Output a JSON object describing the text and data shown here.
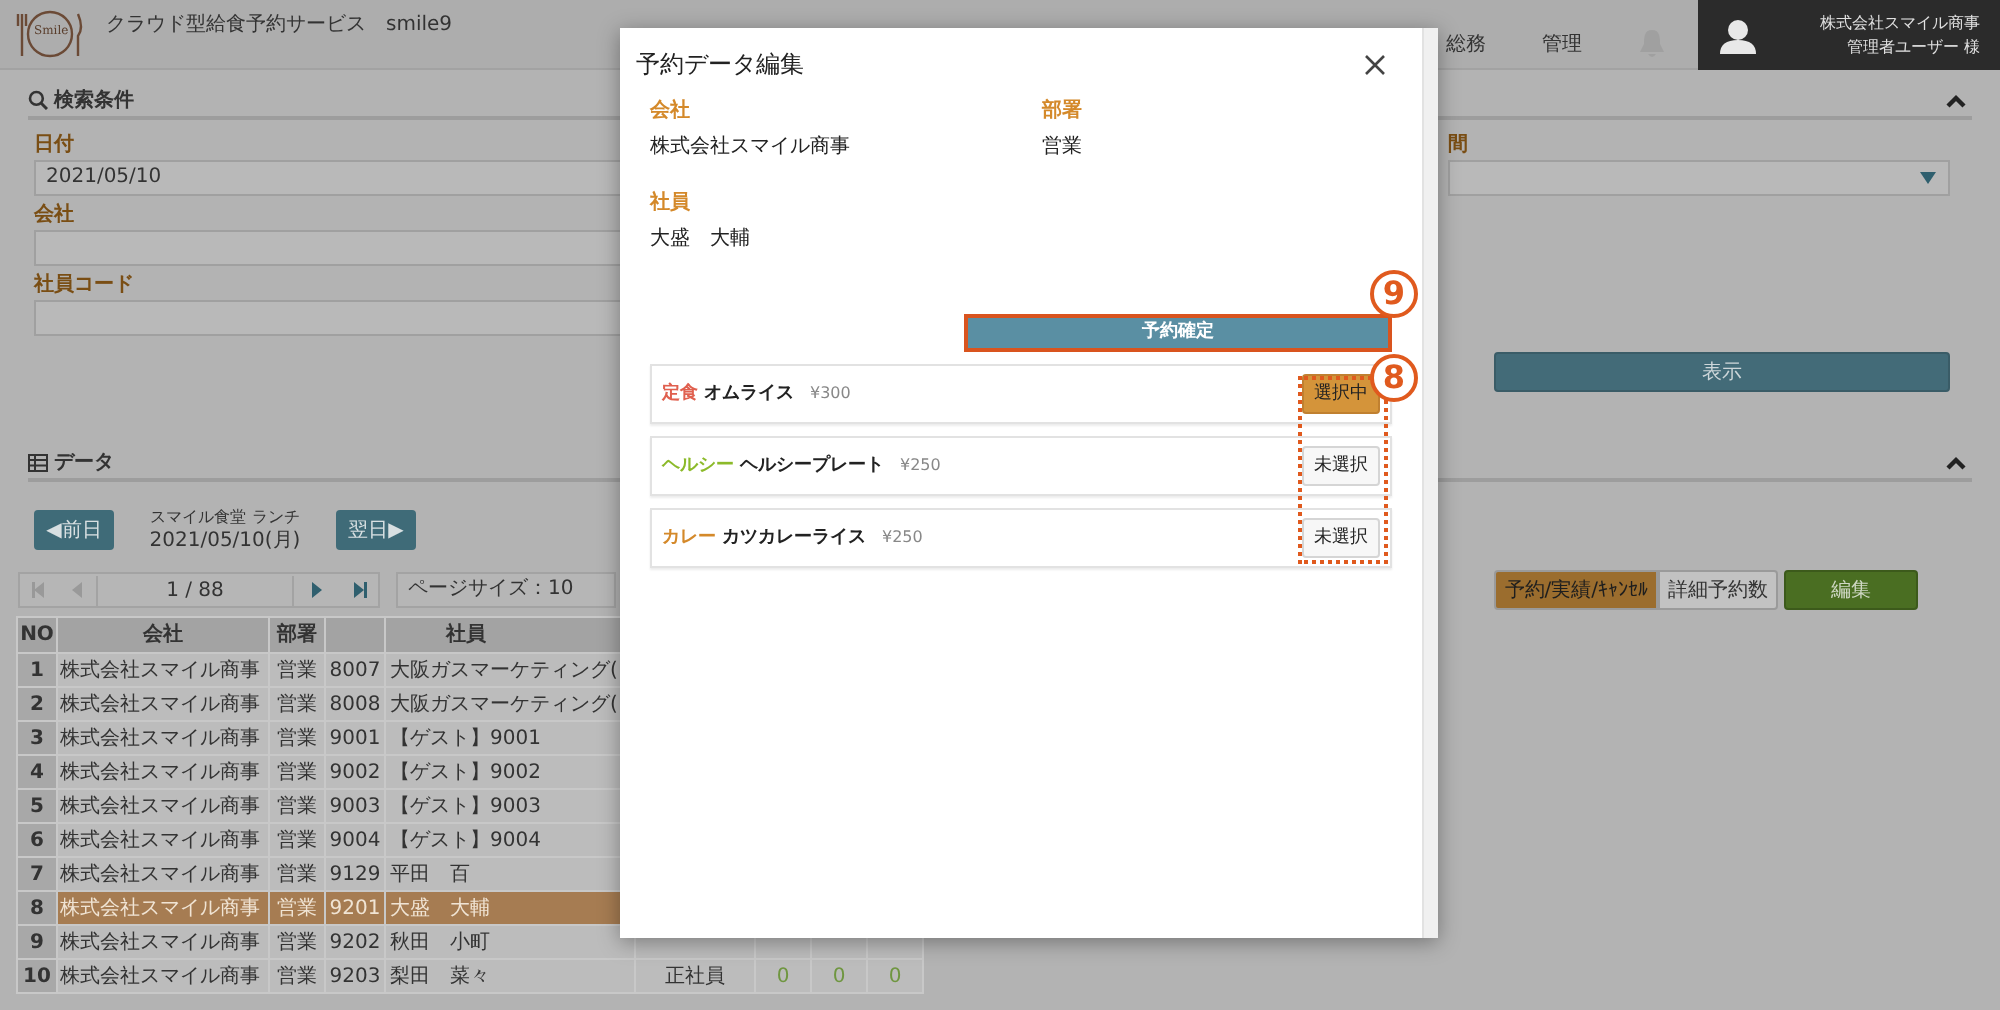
{
  "app": {
    "title": "クラウド型給食予約サービス　smile9",
    "logo_text": "Smile"
  },
  "nav": [
    {
      "label": "総務"
    },
    {
      "label": "管理"
    }
  ],
  "user": {
    "company": "株式会社スマイル商事",
    "name": "管理者ユーザー 様"
  },
  "search": {
    "title": "検索条件",
    "fields": [
      {
        "label": "日付",
        "value": "2021/05/10"
      },
      {
        "label": "会社"
      },
      {
        "label": "社員コード"
      }
    ],
    "right_field": {
      "label": "間",
      "kind": "select"
    },
    "submit": "表示"
  },
  "data": {
    "title": "データ",
    "prev": "◀前日",
    "next": "翌日▶",
    "cafeteria": "スマイル食堂 ランチ",
    "date": "2021/05/10(月)"
  },
  "pager": {
    "page": "1 / 88",
    "page_size": "ページサイズ：10"
  },
  "actions": [
    {
      "label": "予約/実績/ｷｬﾝｾﾙ",
      "kind": "tab",
      "selected": true
    },
    {
      "label": "詳細予約数",
      "kind": "tab",
      "selected": false
    },
    {
      "label": "編集",
      "kind": "primary"
    }
  ],
  "table": {
    "columns": {
      "no": "NO",
      "company": "会社",
      "dept": "部署",
      "employee": "社員"
    },
    "rows": [
      {
        "no": "1",
        "company": "株式会社スマイル商事",
        "dept": "営業",
        "code": "8007",
        "employee": "大阪ガスマーケティング(",
        "selected": false
      },
      {
        "no": "2",
        "company": "株式会社スマイル商事",
        "dept": "営業",
        "code": "8008",
        "employee": "大阪ガスマーケティング(",
        "selected": false
      },
      {
        "no": "3",
        "company": "株式会社スマイル商事",
        "dept": "営業",
        "code": "9001",
        "employee": "【ゲスト】9001",
        "selected": false
      },
      {
        "no": "4",
        "company": "株式会社スマイル商事",
        "dept": "営業",
        "code": "9002",
        "employee": "【ゲスト】9002",
        "selected": false
      },
      {
        "no": "5",
        "company": "株式会社スマイル商事",
        "dept": "営業",
        "code": "9003",
        "employee": "【ゲスト】9003",
        "selected": false
      },
      {
        "no": "6",
        "company": "株式会社スマイル商事",
        "dept": "営業",
        "code": "9004",
        "employee": "【ゲスト】9004",
        "selected": false
      },
      {
        "no": "7",
        "company": "株式会社スマイル商事",
        "dept": "営業",
        "code": "9129",
        "employee": "平田　百",
        "selected": false
      },
      {
        "no": "8",
        "company": "株式会社スマイル商事",
        "dept": "営業",
        "code": "9201",
        "employee": "大盛　大輔",
        "selected": true
      },
      {
        "no": "9",
        "company": "株式会社スマイル商事",
        "dept": "営業",
        "code": "9202",
        "employee": "秋田　小町",
        "selected": false
      },
      {
        "no": "10",
        "company": "株式会社スマイル商事",
        "dept": "営業",
        "code": "9203",
        "employee": "梨田　菜々",
        "selected": false,
        "type": "正社員",
        "counts": [
          "0",
          "0",
          "0"
        ]
      }
    ]
  },
  "modal": {
    "title": "予約データ編集",
    "fields": [
      {
        "label": "会社",
        "value": "株式会社スマイル商事"
      },
      {
        "label": "部署",
        "value": "営業"
      },
      {
        "label": "社員",
        "value": "大盛　大輔"
      }
    ],
    "confirm": {
      "label": "予約確定",
      "callout": "9"
    },
    "menu_callout": "8",
    "menu": [
      {
        "category": "定食",
        "color": "#e0604f",
        "name": "オムライス",
        "price": "¥300",
        "selected": true,
        "button": "選択中"
      },
      {
        "category": "ヘルシー",
        "color": "#8cba2a",
        "name": "ヘルシープレート",
        "price": "¥250",
        "selected": false,
        "button": "未選択"
      },
      {
        "category": "カレー",
        "color": "#d4892a",
        "name": "カツカレーライス",
        "price": "¥250",
        "selected": false,
        "button": "未選択"
      }
    ]
  }
}
